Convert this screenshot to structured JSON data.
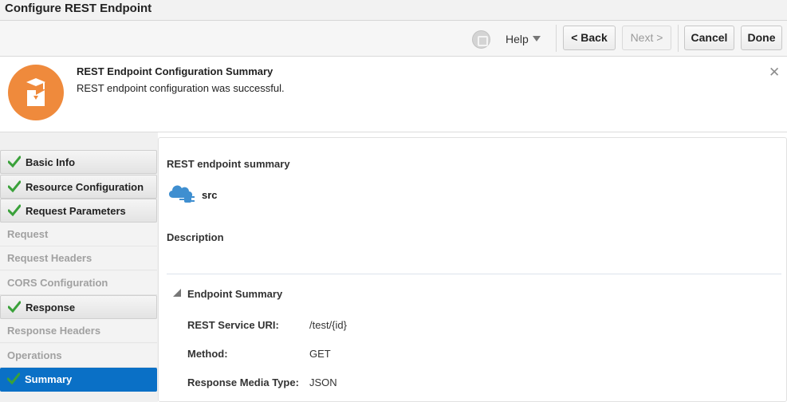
{
  "window": {
    "title": "Configure REST Endpoint"
  },
  "toolbar": {
    "help_label": "Help",
    "back_label": "< Back",
    "next_label": "Next >",
    "cancel_label": "Cancel",
    "done_label": "Done"
  },
  "notification": {
    "title": "REST Endpoint Configuration Summary",
    "message": "REST endpoint configuration was successful.",
    "close_glyph": "✕",
    "icon_color": "#ef8a3c"
  },
  "nav": {
    "items": [
      {
        "label": "Basic Info",
        "state": "done"
      },
      {
        "label": "Resource Configuration",
        "state": "done"
      },
      {
        "label": "Request Parameters",
        "state": "done"
      },
      {
        "label": "Request",
        "state": "todo"
      },
      {
        "label": "Request Headers",
        "state": "todo"
      },
      {
        "label": "CORS Configuration",
        "state": "todo"
      },
      {
        "label": "Response",
        "state": "done"
      },
      {
        "label": "Response Headers",
        "state": "todo"
      },
      {
        "label": "Operations",
        "state": "todo"
      },
      {
        "label": "Summary",
        "state": "active"
      }
    ],
    "check_color": "#3aa13a",
    "active_color": "#0a70c6"
  },
  "content": {
    "summary_heading": "REST endpoint summary",
    "endpoint_name": "src",
    "description_heading": "Description",
    "section_title": "Endpoint Summary",
    "rows": [
      {
        "label": "REST Service URI:",
        "value": "/test/{id}"
      },
      {
        "label": "Method:",
        "value": "GET"
      },
      {
        "label": "Response Media Type:",
        "value": "JSON"
      }
    ]
  }
}
